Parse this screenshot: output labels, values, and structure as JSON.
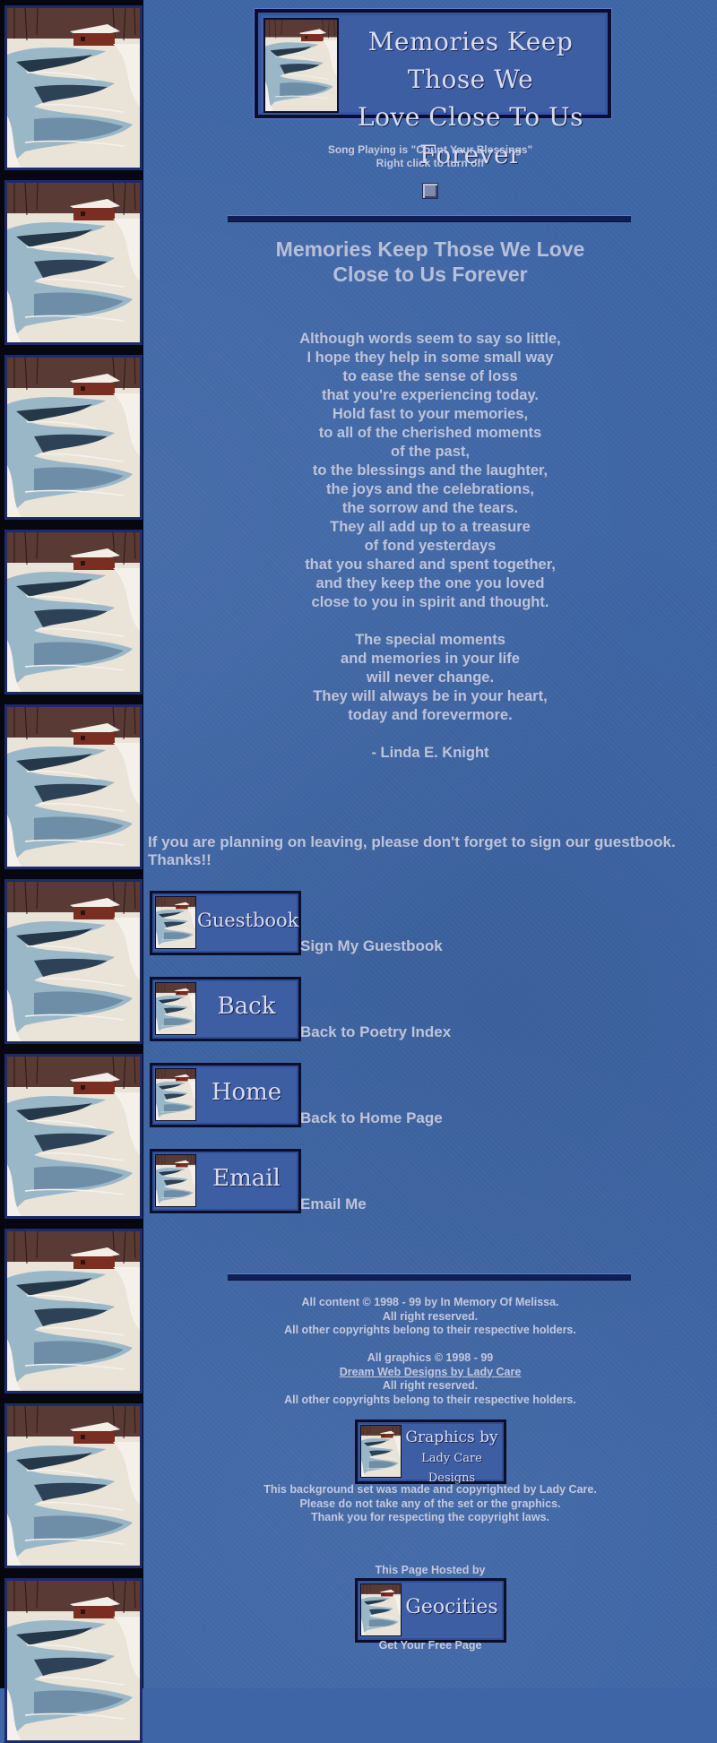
{
  "banner": {
    "line1": "Memories Keep Those We",
    "line2": "Love Close To Us Forever"
  },
  "song": {
    "line1": "Song Playing is \"Count Your Blessings\"",
    "line2": "Right click to turn off"
  },
  "poem_title": {
    "line1": "Memories Keep Those We Love",
    "line2": "Close to Us Forever"
  },
  "poem": {
    "stanza1": [
      "Although words seem to say so little,",
      "I hope they help in some small way",
      "to ease the sense of loss",
      "that you're experiencing today.",
      "Hold fast to your memories,",
      "to all of the cherished moments",
      "of the past,",
      "to the blessings and the laughter,",
      "the joys and the celebrations,",
      "the sorrow and the tears.",
      "They all add up to a treasure",
      "of fond yesterdays",
      "that you shared and spent together,",
      "and they keep the one you loved",
      "close to you in spirit and thought."
    ],
    "stanza2": [
      "The special moments",
      "and memories in your life",
      "will never change.",
      "They will always be in your heart,",
      "today and forevermore."
    ],
    "author": "- Linda E. Knight"
  },
  "leaving_note": "If you are planning on leaving, please don't forget to sign our guestbook. Thanks!!",
  "nav": [
    {
      "button": "Guestbook",
      "text": "Sign My Guestbook"
    },
    {
      "button": "Back",
      "text": "Back to Poetry Index"
    },
    {
      "button": "Home",
      "text": "Back to Home Page"
    },
    {
      "button": "Email",
      "text": "Email Me"
    }
  ],
  "footer": {
    "content_copyright": "All content © 1998 - 99 by In Memory Of Melissa.",
    "rights1": "All right reserved.",
    "other1": "All other copyrights belong to their respective holders.",
    "graphics_copyright": "All graphics © 1998 - 99",
    "designer_link": "Dream Web Designs by Lady Care",
    "rights2": "All right reserved.",
    "other2": "All other copyrights belong to their respective holders.",
    "badge_line1": "Graphics by",
    "badge_line2": "Lady Care Designs",
    "bg_note1": "This background set was made and copyrighted by Lady Care.",
    "bg_note2": "Please do not take any of the set or the graphics.",
    "bg_note3": "Thank you for respecting the copyright laws.",
    "hosted": "This Page Hosted by",
    "host_badge": "Geocities",
    "free_page": "Get Your Free Page"
  },
  "colors": {
    "background": "#3e66a6",
    "strip": "#07070f",
    "text": "#c6c9da",
    "frame": "#0a0e2a"
  }
}
